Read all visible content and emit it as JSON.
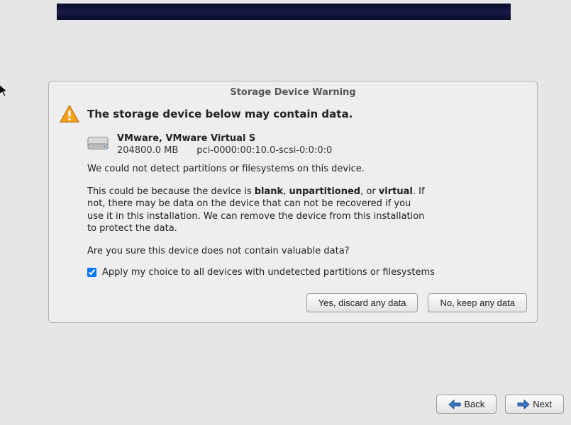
{
  "dialog": {
    "title": "Storage Device Warning",
    "heading": "The storage device below may contain data.",
    "device": {
      "name": "VMware, VMware Virtual S",
      "size": "204800.0 MB",
      "path": "pci-0000:00:10.0-scsi-0:0:0:0"
    },
    "para_detect": "We could not detect partitions or filesystems on this device.",
    "para2_pre": "This could be because the device is ",
    "para2_b1": "blank",
    "para2_sep": ", ",
    "para2_b2": "unpartitioned",
    "para2_mid": ", or ",
    "para2_b3": "virtual",
    "para2_post": ". If not, there may be data on the device that can not be recovered if you use it in this installation. We can remove the device from this installation to protect the data.",
    "para_confirm": "Are you sure this device does not contain valuable data?",
    "apply_label": "Apply my choice to all devices with undetected partitions or filesystems",
    "apply_checked": true,
    "btn_yes": "Yes, discard any data",
    "btn_no": "No, keep any data"
  },
  "nav": {
    "back": "Back",
    "next": "Next"
  }
}
